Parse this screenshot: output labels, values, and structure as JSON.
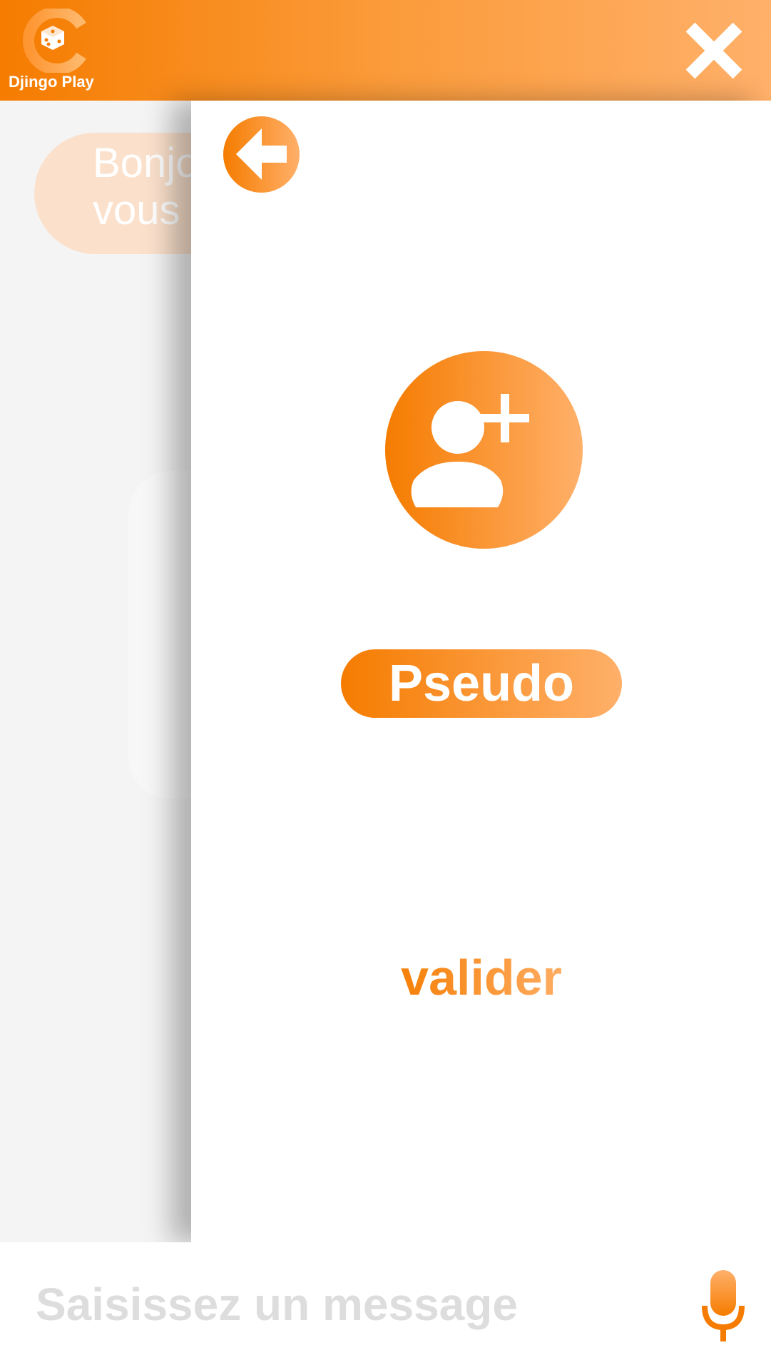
{
  "app": {
    "name": "Djingo Play"
  },
  "header": {
    "close_icon": "close-icon"
  },
  "background_chat": {
    "bubble_text": "Bonjour,\nvous"
  },
  "panel": {
    "back_icon": "arrow-left-icon",
    "avatar_icon": "add-user-icon",
    "pseudo_label": "Pseudo",
    "validate_label": "valider"
  },
  "composer": {
    "placeholder": "Saisissez un message",
    "mic_icon": "microphone-icon"
  },
  "colors": {
    "accent_start": "#f57c00",
    "accent_end": "#ffb06a",
    "placeholder": "#dddddd"
  }
}
